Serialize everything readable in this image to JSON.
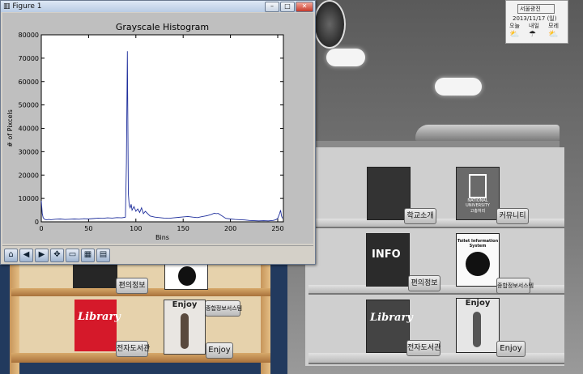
{
  "window": {
    "title": "Figure 1",
    "min": "–",
    "max": "□",
    "close": "✕"
  },
  "chart_data": {
    "type": "line",
    "title": "Grayscale Histogram",
    "xlabel": "Bins",
    "ylabel": "# of Pixcels",
    "xlim": [
      0,
      256
    ],
    "ylim": [
      0,
      80000
    ],
    "xticks": [
      0,
      50,
      100,
      150,
      200,
      250
    ],
    "yticks": [
      0,
      10000,
      20000,
      30000,
      40000,
      50000,
      60000,
      70000,
      80000
    ],
    "line_color": "#1f2f9c",
    "series": [
      {
        "x": [
          0,
          1,
          2,
          3,
          4,
          5,
          6,
          8,
          10,
          15,
          20,
          25,
          30,
          35,
          40,
          45,
          50,
          55,
          60,
          65,
          70,
          75,
          80,
          85,
          88,
          89,
          90,
          91,
          92,
          93,
          94,
          95,
          96,
          98,
          100,
          102,
          104,
          106,
          108,
          110,
          115,
          120,
          125,
          130,
          135,
          140,
          145,
          150,
          155,
          160,
          165,
          170,
          175,
          180,
          183,
          185,
          187,
          190,
          195,
          200,
          205,
          210,
          215,
          220,
          225,
          230,
          235,
          240,
          245,
          248,
          250,
          252,
          253,
          254,
          255
        ],
        "values": [
          9000,
          3500,
          1800,
          1200,
          1000,
          900,
          900,
          1000,
          900,
          1100,
          1200,
          1000,
          1100,
          1200,
          1100,
          1300,
          1200,
          1400,
          1600,
          1500,
          1700,
          1600,
          1800,
          1700,
          1900,
          2000,
          25000,
          73000,
          12000,
          7000,
          6000,
          7500,
          5000,
          6500,
          4500,
          5500,
          4000,
          6000,
          3500,
          4500,
          2500,
          2000,
          1800,
          1600,
          1500,
          1700,
          1900,
          2100,
          2300,
          2000,
          1800,
          2200,
          2600,
          3200,
          3700,
          3500,
          3600,
          2800,
          1500,
          1200,
          1000,
          900,
          800,
          600,
          500,
          400,
          500,
          400,
          600,
          900,
          1500,
          3500,
          5000,
          2500,
          1500
        ]
      }
    ]
  },
  "toolbar": {
    "home": "⌂",
    "back": "◀",
    "forward": "▶",
    "pan": "✥",
    "zoom": "▭",
    "subplots": "▦",
    "save": "▤"
  },
  "right": {
    "weather": {
      "region": "서울광진",
      "date": "2013/11/17 (일)",
      "days": [
        "오늘",
        "내일",
        "모레"
      ]
    },
    "shelf1": {
      "tag1": "학교소개",
      "tag2": "커뮤니티",
      "book2_top": "NATIONAL UNIVERSITY",
      "book2_sub": "고충처리"
    },
    "shelf2": {
      "book1": "INFO",
      "tag1": "편의정보",
      "book2_title": "Toilet Information System",
      "tag2": "종합정보서스템"
    },
    "shelf3": {
      "book1": "Library",
      "tag1": "전자도서관",
      "book2": "Enjoy",
      "tag2": "Enjoy"
    }
  },
  "left": {
    "shelf2": {
      "tag1": "편의정보",
      "tag2": "종합정보서스템"
    },
    "shelf3": {
      "book1": "Library",
      "tag1": "전자도서관",
      "book2": "Enjoy",
      "tag2": "Enjoy"
    }
  }
}
